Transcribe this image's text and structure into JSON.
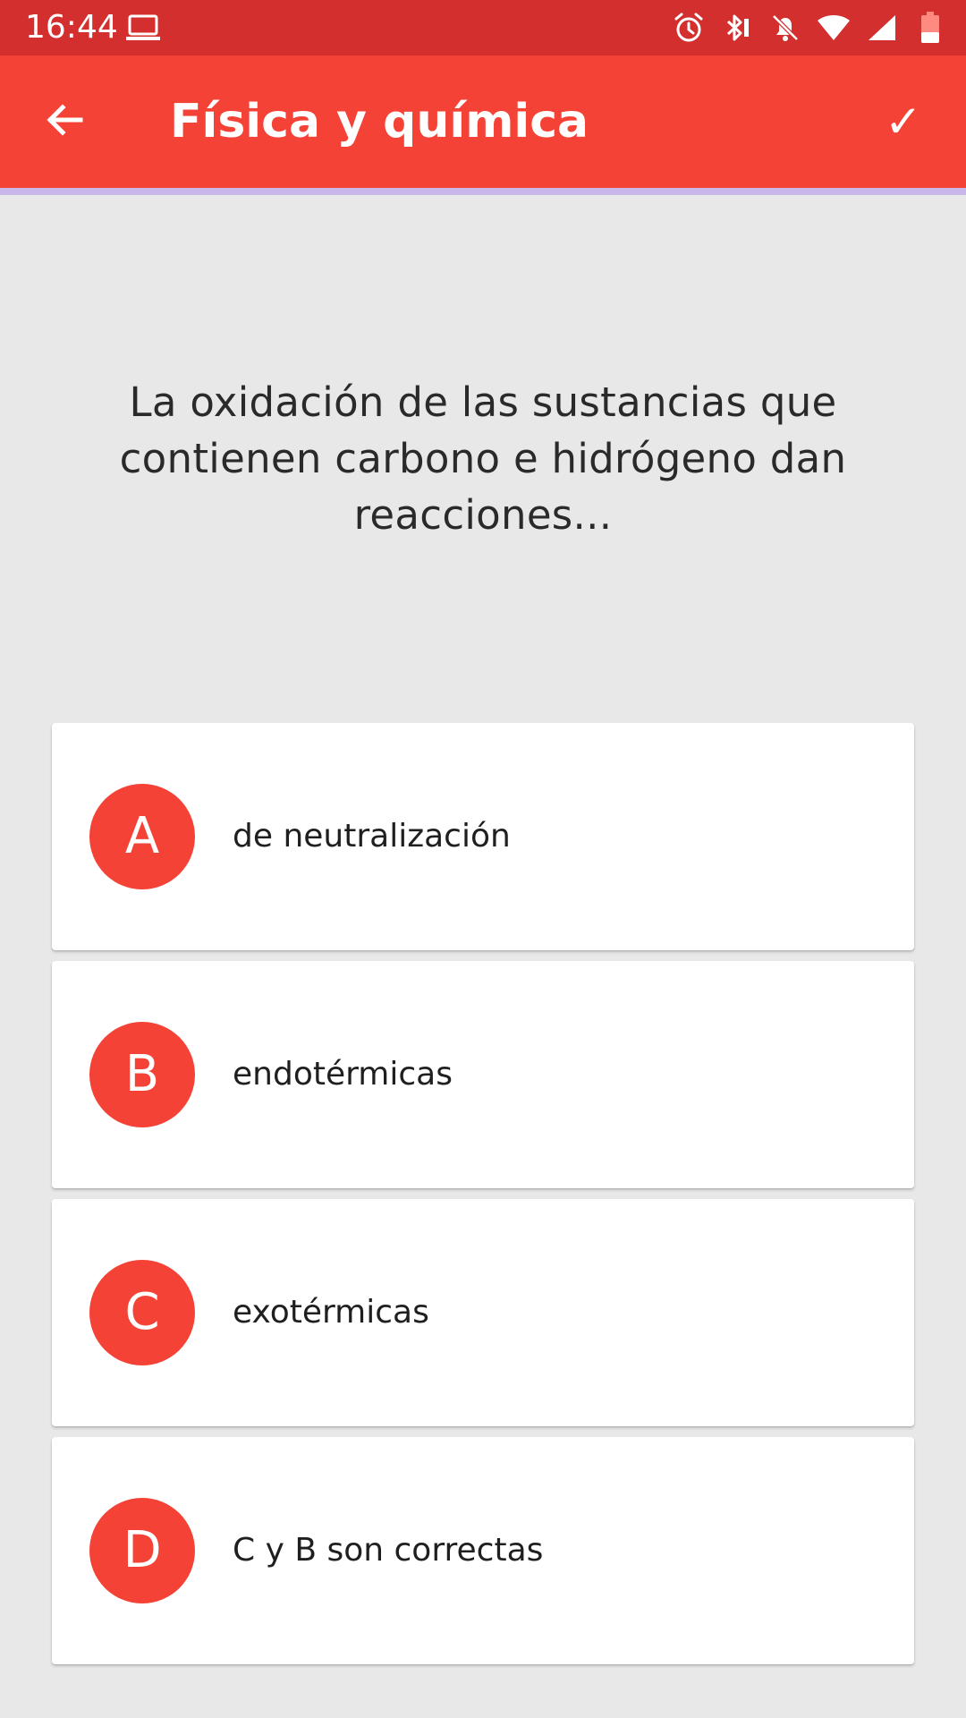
{
  "status_bar": {
    "time": "16:44",
    "icons": [
      "laptop-icon",
      "alarm-icon",
      "bluetooth-icon",
      "notifications-off-icon",
      "wifi-icon",
      "signal-icon",
      "battery-low-icon"
    ]
  },
  "app_bar": {
    "back_icon": "arrow-back-icon",
    "title": "Física y química",
    "confirm_label": "✓"
  },
  "question": {
    "text": "La oxidación de las sustancias que contienen carbono e hidrógeno dan reacciones..."
  },
  "answers": [
    {
      "letter": "A",
      "text": "de neutralización"
    },
    {
      "letter": "B",
      "text": "endotérmicas"
    },
    {
      "letter": "C",
      "text": "exotérmicas"
    },
    {
      "letter": "D",
      "text": "C y B son correctas"
    }
  ],
  "colors": {
    "status_bar": "#d32f2f",
    "app_bar": "#f44336",
    "accent_line": "#c9b7e9",
    "background": "#e8e8e8",
    "letter_circle": "#f44336"
  }
}
